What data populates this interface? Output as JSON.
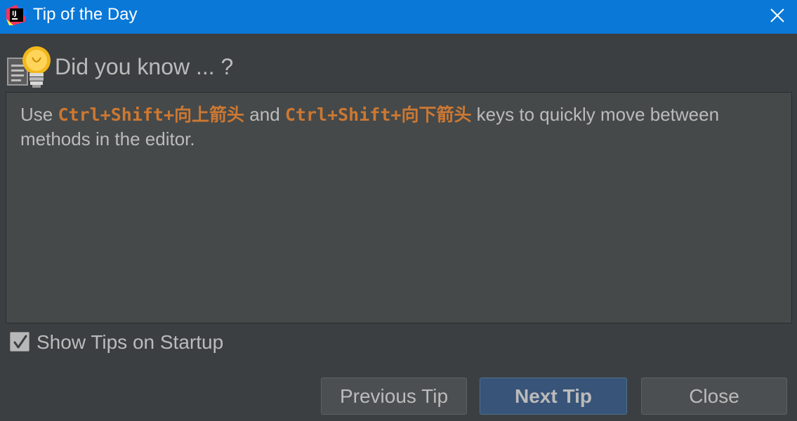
{
  "window": {
    "title": "Tip of the Day",
    "app_icon": "intellij-idea-icon",
    "close_icon": "close-icon"
  },
  "header": {
    "icon": "lightbulb-icon",
    "title": "Did you know ... ?"
  },
  "tip": {
    "prefix": "Use ",
    "shortcut_up": "Ctrl+Shift+向上箭头",
    "middle": " and ",
    "shortcut_down": "Ctrl+Shift+向下箭头",
    "suffix": " keys to quickly move between methods in the editor."
  },
  "startup_checkbox": {
    "label": "Show Tips on Startup",
    "checked": true
  },
  "buttons": {
    "previous": "Previous Tip",
    "next": "Next Tip",
    "close": "Close"
  },
  "colors": {
    "titlebar": "#0a78d7",
    "background": "#3c3f41",
    "panel": "#45494a",
    "text": "#bbbbbb",
    "shortcut": "#cc7832",
    "default_button": "#385478"
  }
}
